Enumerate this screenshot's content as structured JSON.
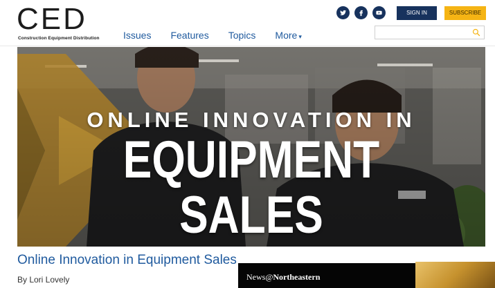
{
  "logo": {
    "mark": "CED",
    "subtitle": "Construction Equipment Distribution"
  },
  "nav": {
    "items": [
      {
        "label": "Issues"
      },
      {
        "label": "Features"
      },
      {
        "label": "Topics"
      },
      {
        "label": "More"
      }
    ]
  },
  "social": {
    "icons": [
      "twitter-icon",
      "facebook-icon",
      "youtube-icon"
    ]
  },
  "auth": {
    "signin_label": "SIGN IN",
    "subscribe_label": "SUBSCRIBE"
  },
  "search": {
    "value": "",
    "placeholder": ""
  },
  "hero": {
    "line1": "ONLINE INNOVATION IN",
    "line2": "EQUIPMENT SALES"
  },
  "article": {
    "title": "Online Innovation in Equipment Sales",
    "byline": "By Lori Lovely"
  },
  "news_banner": {
    "prefix": "News@",
    "brand": "Northeastern"
  },
  "colors": {
    "nav_link": "#1f5a9e",
    "brand_navy": "#17325d",
    "subscribe_yellow": "#f5b414",
    "accent_gold": "#d6a53b"
  }
}
